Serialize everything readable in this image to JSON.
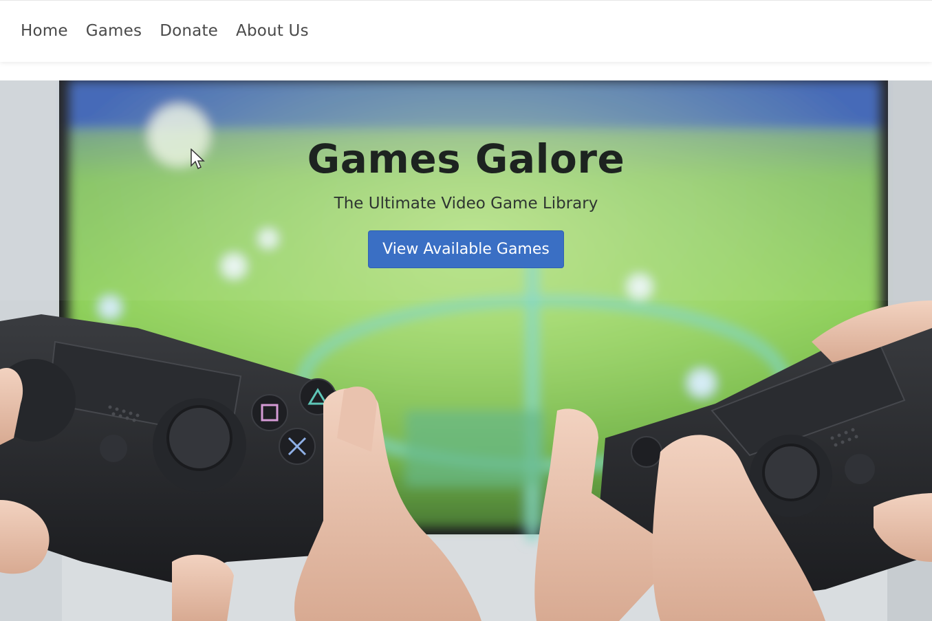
{
  "nav": {
    "items": [
      {
        "label": "Home"
      },
      {
        "label": "Games"
      },
      {
        "label": "Donate"
      },
      {
        "label": "About Us"
      }
    ]
  },
  "hero": {
    "title": "Games Galore",
    "subtitle": "The Ultimate Video Game Library",
    "cta_label": "View Available Games",
    "background_image": "gamepad-controllers-football-tv-photo"
  },
  "colors": {
    "accent": "#3a6fc4",
    "nav_text": "#4a4a4a",
    "title_text": "#1d2320"
  },
  "icons": {
    "cursor": "mouse-pointer-icon"
  }
}
